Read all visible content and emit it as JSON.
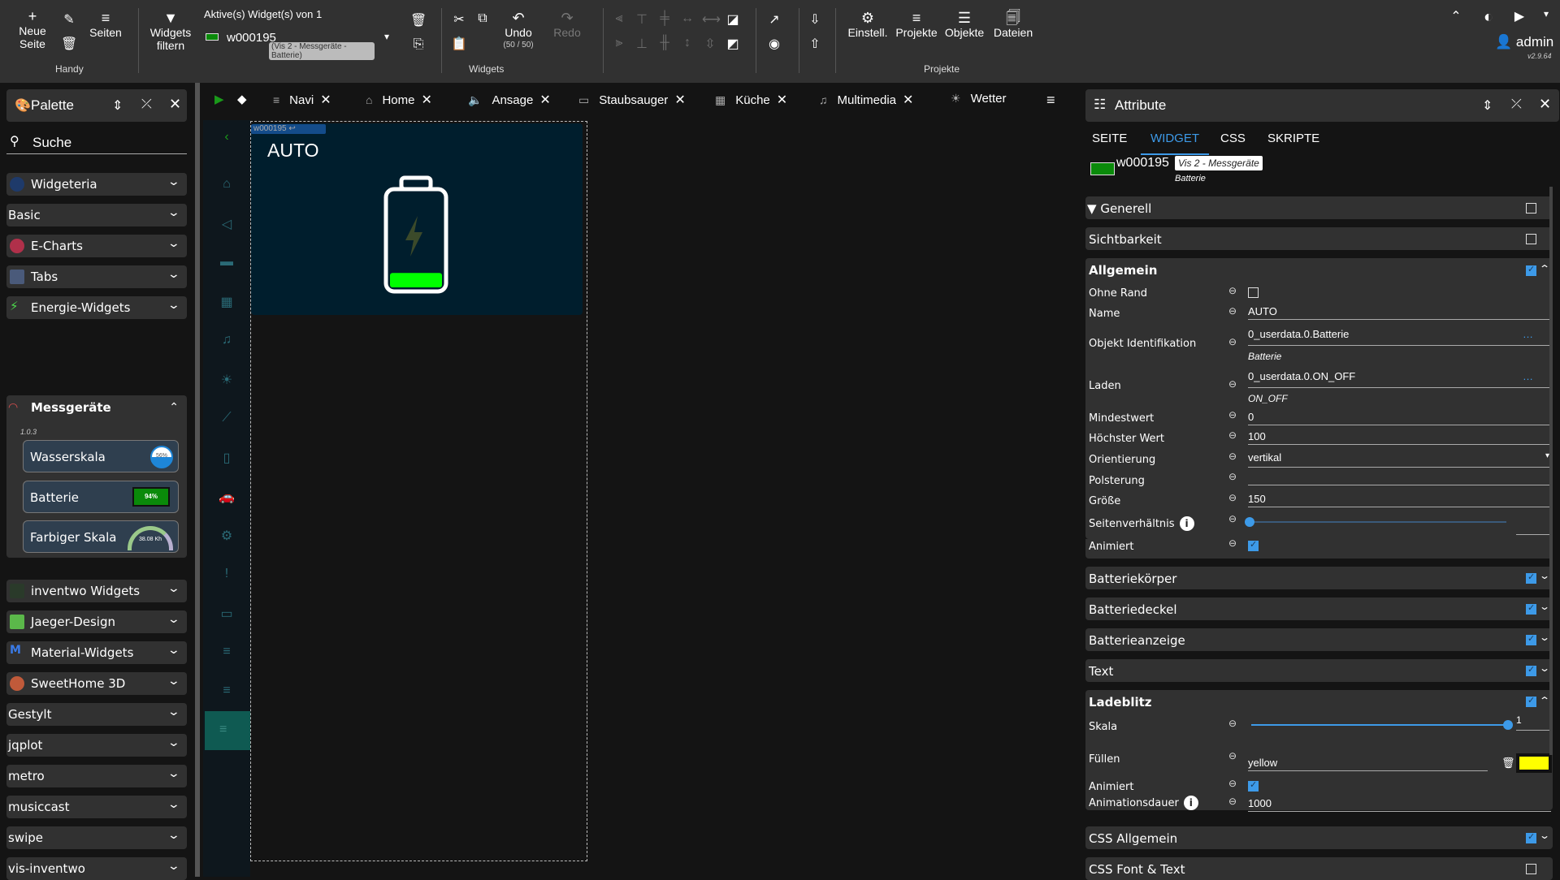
{
  "toolbar": {
    "neue_seite": "Neue Seite",
    "seiten": "Seiten",
    "handy": "Handy",
    "widgets_filtern": "Widgets filtern",
    "active_widgets": "Aktive(s) Widget(s) von 1",
    "widget_id": "w000195",
    "widget_badge": "(Vis 2 - Messgeräte - Batterie)",
    "undo": "Undo",
    "undo_count": "(50 / 50)",
    "redo": "Redo",
    "widgets_group": "Widgets",
    "einstell": "Einstell.",
    "projekte": "Projekte",
    "objekte": "Objekte",
    "dateien": "Dateien",
    "projekte_group": "Projekte",
    "user": "admin",
    "version": "v2.9.64"
  },
  "palette": {
    "title": "Palette",
    "search": "Suche",
    "items": [
      {
        "label": "Widgeteria",
        "icon": "widgeteria-icon"
      },
      {
        "label": "Basic"
      },
      {
        "label": "E-Charts",
        "icon": "echarts-icon"
      },
      {
        "label": "Tabs",
        "icon": "tabs-icon"
      },
      {
        "label": "Energie-Widgets",
        "icon": "lightning-icon"
      },
      {
        "label": "inventwo Widgets",
        "icon": "inventwo-icon"
      },
      {
        "label": "Jaeger-Design",
        "icon": "jaeger-icon"
      },
      {
        "label": "Material-Widgets",
        "icon": "material-icon"
      },
      {
        "label": "SweetHome 3D",
        "icon": "sweethome-icon"
      },
      {
        "label": "Gestylt"
      },
      {
        "label": "jqplot"
      },
      {
        "label": "metro"
      },
      {
        "label": "musiccast"
      },
      {
        "label": "swipe"
      },
      {
        "label": "vis-inventwo"
      }
    ],
    "messgeraete": {
      "label": "Messgeräte",
      "version": "1.0.3",
      "widgets": [
        {
          "label": "Wasserskala",
          "preview": "56%"
        },
        {
          "label": "Batterie",
          "preview": "94%"
        },
        {
          "label": "Farbiger Skala",
          "preview": "38.08 Kh"
        }
      ]
    }
  },
  "tabs": [
    {
      "label": "Navi"
    },
    {
      "label": "Home"
    },
    {
      "label": "Ansage"
    },
    {
      "label": "Staubsauger"
    },
    {
      "label": "Küche"
    },
    {
      "label": "Multimedia"
    },
    {
      "label": "Wetter"
    }
  ],
  "widget": {
    "label_tag": "w000195",
    "name": "AUTO",
    "level_percent": 15,
    "bolt_color": "#3b4a2a",
    "fill_color": "#00ff00"
  },
  "attributes": {
    "title": "Attribute",
    "tabs": [
      "SEITE",
      "WIDGET",
      "CSS",
      "SKRIPTE"
    ],
    "active_tab": "WIDGET",
    "widget_id": "w000195",
    "widget_set": "Vis 2 - Messgeräte",
    "widget_type": "Batterie",
    "sections": {
      "generell": "Generell",
      "sichtbarkeit": "Sichtbarkeit",
      "allgemein": "Allgemein",
      "batteriekoerper": "Batteriekörper",
      "batteriedeckel": "Batteriedeckel",
      "batterieanzeige": "Batterieanzeige",
      "text": "Text",
      "ladeblitz": "Ladeblitz",
      "css_allgemein": "CSS Allgemein",
      "css_font": "CSS Font & Text"
    },
    "allgemein": {
      "ohne_rand": "Ohne Rand",
      "name_label": "Name",
      "name": "AUTO",
      "oid_label": "Objekt Identifikation",
      "oid": "0_userdata.0.Batterie",
      "oid_sub": "Batterie",
      "laden_label": "Laden",
      "laden": "0_userdata.0.ON_OFF",
      "laden_sub": "ON_OFF",
      "min_label": "Mindestwert",
      "min": "0",
      "max_label": "Höchster Wert",
      "max": "100",
      "orient_label": "Orientierung",
      "orient": "vertikal",
      "pad_label": "Polsterung",
      "pad": "",
      "size_label": "Größe",
      "size": "150",
      "ratio_label": "Seitenverhältnis",
      "ratio_value": 0,
      "anim_label": "Animiert"
    },
    "ladeblitz": {
      "skala_label": "Skala",
      "skala": "1",
      "fill_label": "Füllen",
      "fill": "yellow",
      "fill_color": "#ffff00",
      "anim_label": "Animiert",
      "dur_label": "Animationsdauer",
      "dur": "1000"
    }
  }
}
